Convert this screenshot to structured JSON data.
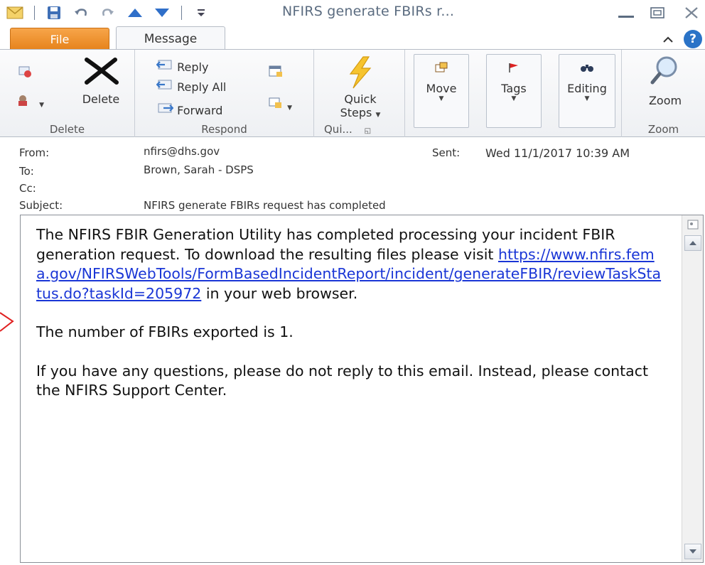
{
  "window": {
    "title": "NFIRS generate FBIRs r...",
    "minimize": "minimize",
    "maximize": "maximize",
    "close": "close"
  },
  "tabs": [
    {
      "label": "File"
    },
    {
      "label": "Message"
    }
  ],
  "ribbon": {
    "delete_group": {
      "label": "Delete",
      "delete_button": "Delete"
    },
    "respond_group": {
      "label": "Respond",
      "reply": "Reply",
      "reply_all": "Reply All",
      "forward": "Forward"
    },
    "quick_steps_group": {
      "label": "Qui...",
      "quick_line1": "Quick",
      "quick_line2": "Steps"
    },
    "move": "Move",
    "tags": "Tags",
    "editing": "Editing",
    "zoom_group": {
      "label": "Zoom",
      "zoom_button": "Zoom"
    }
  },
  "header": {
    "from_label": "From:",
    "from_value": "nfirs@dhs.gov",
    "to_label": "To:",
    "to_value": "Brown, Sarah - DSPS",
    "cc_label": "Cc:",
    "cc_value": "",
    "subject_label": "Subject:",
    "subject_value": "NFIRS generate FBIRs request has completed",
    "sent_label": "Sent:",
    "sent_value": "Wed 11/1/2017 10:39 AM"
  },
  "message": {
    "para1_text": "The NFIRS FBIR Generation Utility has completed processing your incident FBIR generation request.  To download the resulting files please visit",
    "link": "https://www.nfirs.fema.gov/NFIRSWebTools/FormBasedIncidentReport/incident/generateFBIR/reviewTaskStatus.do?taskId=205972",
    "para1_tail": "in your web browser.",
    "para2": "The number of FBIRs exported is 1.",
    "para3": "If you have any questions, please do not reply to this email. Instead, please contact the NFIRS Support Center."
  },
  "colors": {
    "file_tab": "#e6831c",
    "link": "#1a36d6",
    "help": "#2a73c7"
  }
}
